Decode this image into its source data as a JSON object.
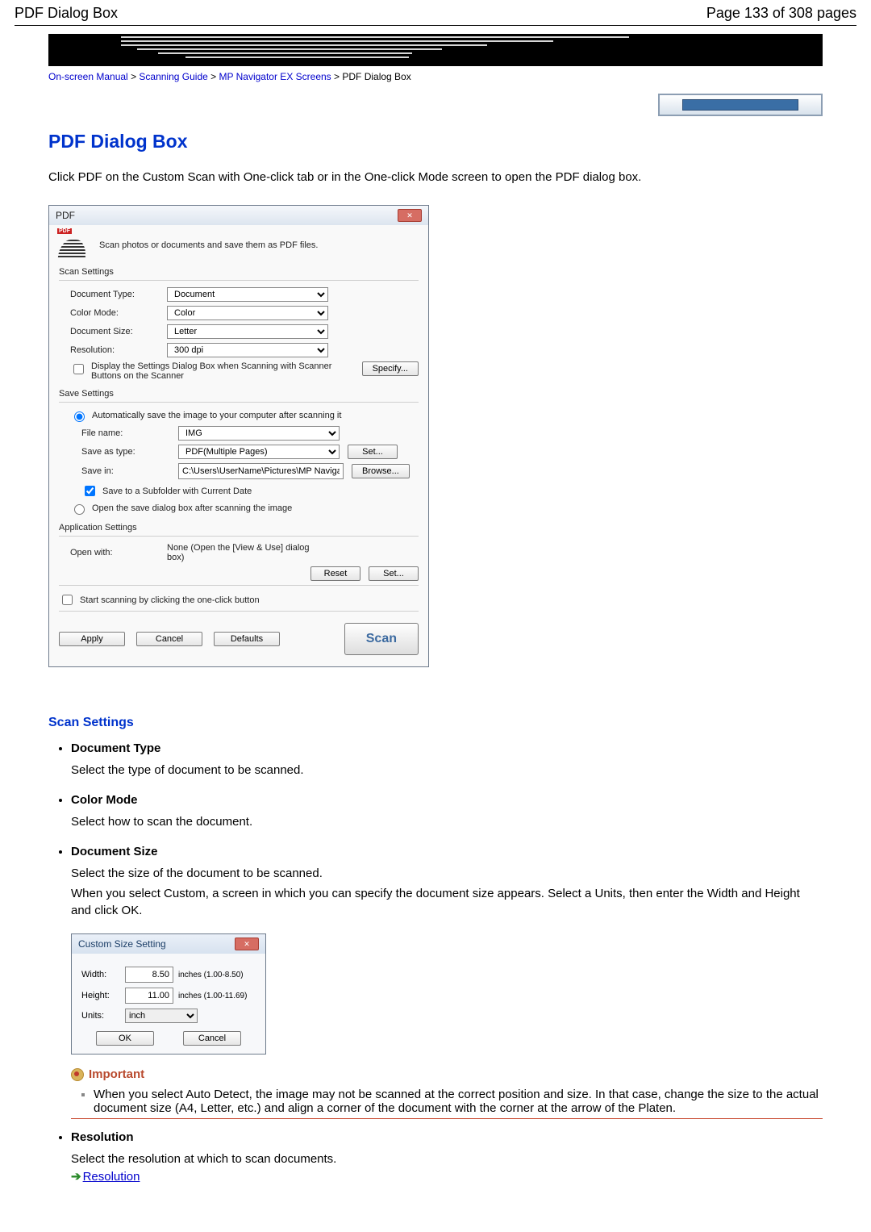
{
  "header": {
    "left": "PDF Dialog Box",
    "right": "Page 133 of 308 pages"
  },
  "breadcrumb": {
    "items": [
      "On-screen Manual",
      "Scanning Guide",
      "MP Navigator EX Screens"
    ],
    "current": "PDF Dialog Box",
    "sep": " > "
  },
  "page_title": "PDF Dialog Box",
  "intro": "Click PDF on the Custom Scan with One-click tab or in the One-click Mode screen to open the PDF dialog box.",
  "dialog": {
    "title": "PDF",
    "desc": "Scan photos or documents and save them as PDF files.",
    "pdf_label": "PDF",
    "groups": {
      "scan": "Scan Settings",
      "save": "Save Settings",
      "app": "Application Settings"
    },
    "doc_type_label": "Document Type:",
    "doc_type_value": "Document",
    "color_label": "Color Mode:",
    "color_value": "Color",
    "size_label": "Document Size:",
    "size_value": "Letter",
    "res_label": "Resolution:",
    "res_value": "300 dpi",
    "display_chk": "Display the Settings Dialog Box when Scanning with Scanner Buttons on the Scanner",
    "specify_btn": "Specify...",
    "auto_save_radio": "Automatically save the image to your computer after scanning it",
    "file_name_label": "File name:",
    "file_name_value": "IMG",
    "save_as_label": "Save as type:",
    "save_as_value": "PDF(Multiple Pages)",
    "set_btn": "Set...",
    "save_in_label": "Save in:",
    "save_in_value": "C:\\Users\\UserName\\Pictures\\MP Navigato",
    "browse_btn": "Browse...",
    "subfolder_chk": "Save to a Subfolder with Current Date",
    "open_save_radio": "Open the save dialog box after scanning the image",
    "open_with_label": "Open with:",
    "open_with_value": "None (Open the [View & Use] dialog box)",
    "reset_btn": "Reset",
    "set_btn2": "Set...",
    "start_chk": "Start scanning by clicking the one-click button",
    "apply_btn": "Apply",
    "cancel_btn": "Cancel",
    "defaults_btn": "Defaults",
    "scan_btn": "Scan"
  },
  "sections": {
    "scan_heading": "Scan Settings",
    "doc_type_t": "Document Type",
    "doc_type_b": "Select the type of document to be scanned.",
    "color_t": "Color Mode",
    "color_b": "Select how to scan the document.",
    "size_t": "Document Size",
    "size_b1": "Select the size of the document to be scanned.",
    "size_b2": "When you select Custom, a screen in which you can specify the document size appears. Select a Units, then enter the Width and Height and click OK.",
    "res_t": "Resolution",
    "res_b": "Select the resolution at which to scan documents.",
    "res_link": "Resolution"
  },
  "custom_dialog": {
    "title": "Custom Size Setting",
    "width_label": "Width:",
    "width_value": "8.50",
    "width_hint": "inches (1.00-8.50)",
    "height_label": "Height:",
    "height_value": "11.00",
    "height_hint": "inches (1.00-11.69)",
    "units_label": "Units:",
    "units_value": "inch",
    "ok": "OK",
    "cancel": "Cancel"
  },
  "important": {
    "heading": "Important",
    "text": "When you select Auto Detect, the image may not be scanned at the correct position and size. In that case, change the size to the actual document size (A4, Letter, etc.) and align a corner of the document with the corner at the arrow of the Platen."
  }
}
